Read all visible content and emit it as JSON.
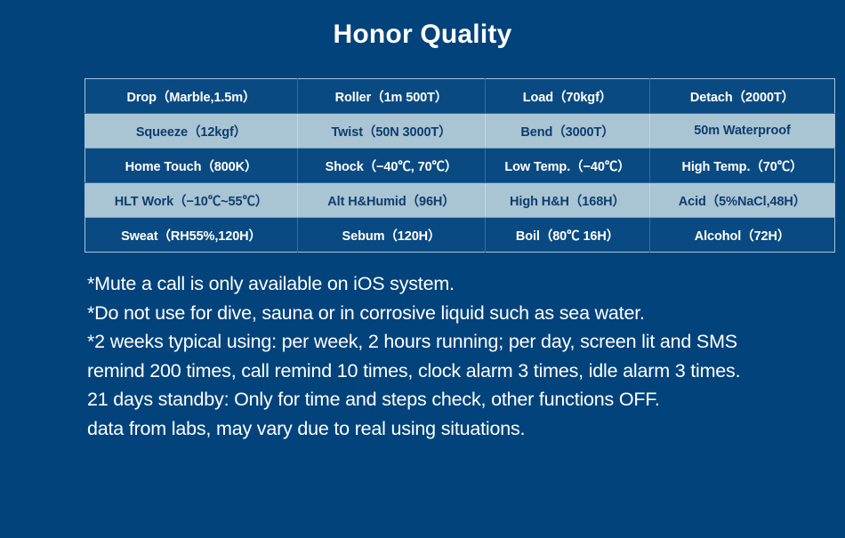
{
  "page": {
    "title": "Honor Quality",
    "background_color": "#02437c",
    "row_dark_color": "#0a4a82",
    "row_light_color": "#a9c4d3",
    "text_light_color": "#ffffff",
    "text_dark_color": "#0d3d6e"
  },
  "table": {
    "rows": [
      {
        "style": "dark",
        "cells": [
          "Drop（Marble,1.5m）",
          "Roller（1m 500T）",
          "Load（70kgf）",
          "Detach（2000T）"
        ]
      },
      {
        "style": "light",
        "cells": [
          "Squeeze（12kgf）",
          "Twist（50N 3000T）",
          "Bend（3000T）",
          "50m Waterproof"
        ]
      },
      {
        "style": "dark",
        "cells": [
          "Home Touch（800K）",
          "Shock（−40℃, 70℃）",
          "Low Temp.（−40℃）",
          "High Temp.（70℃）"
        ]
      },
      {
        "style": "light",
        "cells": [
          "HLT Work（−10℃~55℃）",
          "Alt H&Humid（96H）",
          "High H&H（168H）",
          "Acid（5%NaCl,48H）"
        ]
      },
      {
        "style": "dark",
        "cells": [
          "Sweat（RH55%,120H）",
          "Sebum（120H）",
          "Boil（80℃ 16H）",
          "Alcohol（72H）"
        ]
      }
    ]
  },
  "notes": {
    "line1": "*Mute a call is only available on iOS system.",
    "line2": "*Do not use for dive, sauna or in corrosive liquid such as sea water.",
    "line3": "*2 weeks typical using: per week, 2 hours running; per day, screen lit and SMS remind 200 times, call remind 10 times, clock alarm 3 times, idle alarm 3 times.",
    "line4": "21 days standby: Only for time and steps check, other functions OFF.",
    "line5": "data from labs, may vary due to real using situations."
  }
}
